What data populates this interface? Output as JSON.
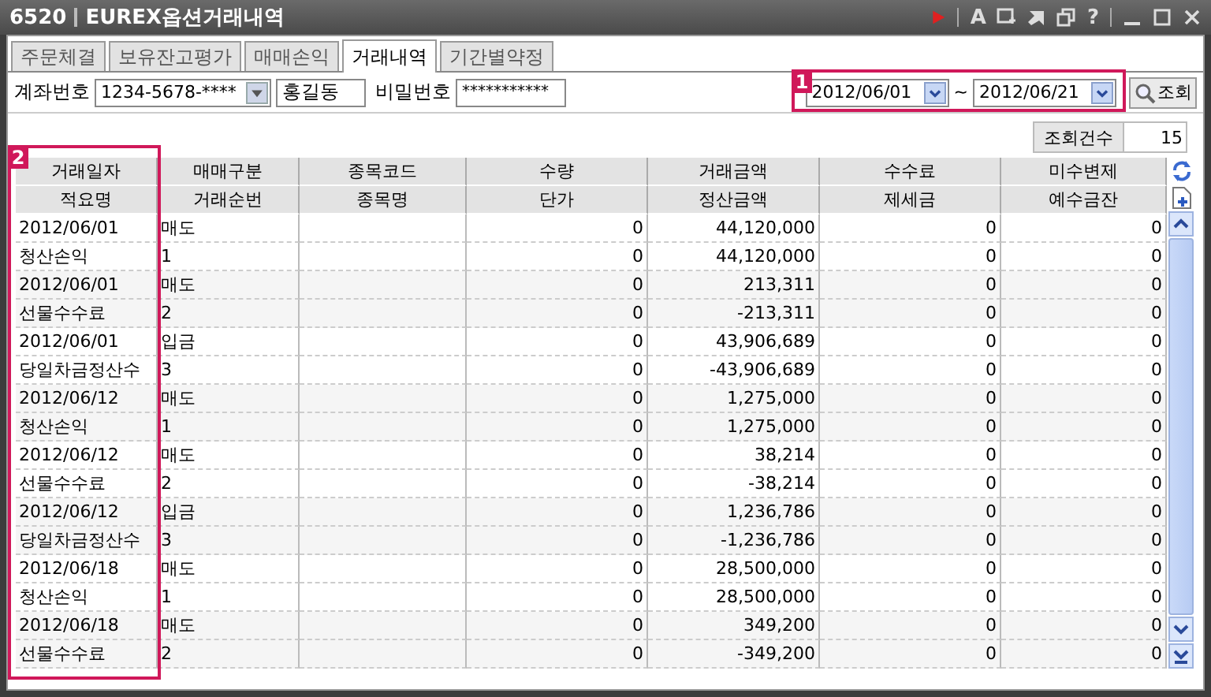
{
  "window": {
    "code": "6520",
    "title": "EUREX옵션거래내역",
    "font_button": "A",
    "help_button": "?"
  },
  "tabs": [
    {
      "label": "주문체결",
      "selected": false
    },
    {
      "label": "보유잔고평가",
      "selected": false
    },
    {
      "label": "매매손익",
      "selected": false
    },
    {
      "label": "거래내역",
      "selected": true
    },
    {
      "label": "기간별약정",
      "selected": false
    }
  ],
  "account": {
    "label": "계좌번호",
    "value": "1234-5678-****",
    "holder": "홍길동",
    "password_label": "비밀번호",
    "password": "***********"
  },
  "date_range": {
    "from": "2012/06/01",
    "separator": "~",
    "to": "2012/06/21",
    "search_button": "조회"
  },
  "count": {
    "label": "조회건수",
    "value": "15"
  },
  "table": {
    "columns": [
      {
        "top": "거래일자",
        "bottom": "적요명"
      },
      {
        "top": "매매구분",
        "bottom": "거래순번"
      },
      {
        "top": "종목코드",
        "bottom": "종목명"
      },
      {
        "top": "수량",
        "bottom": "단가"
      },
      {
        "top": "거래금액",
        "bottom": "정산금액"
      },
      {
        "top": "수수료",
        "bottom": "제세금"
      },
      {
        "top": "미수변제",
        "bottom": "예수금잔"
      }
    ],
    "rows": [
      [
        "2012/06/01",
        "매도",
        null,
        "0",
        "44,120,000",
        "0",
        "0"
      ],
      [
        "청산손익",
        "1",
        null,
        "0",
        "44,120,000",
        "0",
        "0"
      ],
      [
        "2012/06/01",
        "매도",
        null,
        "0",
        "213,311",
        "0",
        "0"
      ],
      [
        "선물수수료",
        "2",
        null,
        "0",
        "-213,311",
        "0",
        "0"
      ],
      [
        "2012/06/01",
        "입금",
        null,
        "0",
        "43,906,689",
        "0",
        "0"
      ],
      [
        "당일차금정산수",
        "3",
        null,
        "0",
        "-43,906,689",
        "0",
        "0"
      ],
      [
        "2012/06/12",
        "매도",
        null,
        "0",
        "1,275,000",
        "0",
        "0"
      ],
      [
        "청산손익",
        "1",
        null,
        "0",
        "1,275,000",
        "0",
        "0"
      ],
      [
        "2012/06/12",
        "매도",
        null,
        "0",
        "38,214",
        "0",
        "0"
      ],
      [
        "선물수수료",
        "2",
        null,
        "0",
        "-38,214",
        "0",
        "0"
      ],
      [
        "2012/06/12",
        "입금",
        null,
        "0",
        "1,236,786",
        "0",
        "0"
      ],
      [
        "당일차금정산수",
        "3",
        null,
        "0",
        "-1,236,786",
        "0",
        "0"
      ],
      [
        "2012/06/18",
        "매도",
        null,
        "0",
        "28,500,000",
        "0",
        "0"
      ],
      [
        "청산손익",
        "1",
        null,
        "0",
        "28,500,000",
        "0",
        "0"
      ],
      [
        "2012/06/18",
        "매도",
        null,
        "0",
        "349,200",
        "0",
        "0"
      ],
      [
        "선물수수료",
        "2",
        null,
        "0",
        "-349,200",
        "0",
        "0"
      ]
    ]
  },
  "annotations": [
    {
      "label": "1",
      "kind": "dates"
    },
    {
      "label": "2",
      "kind": "first_column"
    }
  ]
}
